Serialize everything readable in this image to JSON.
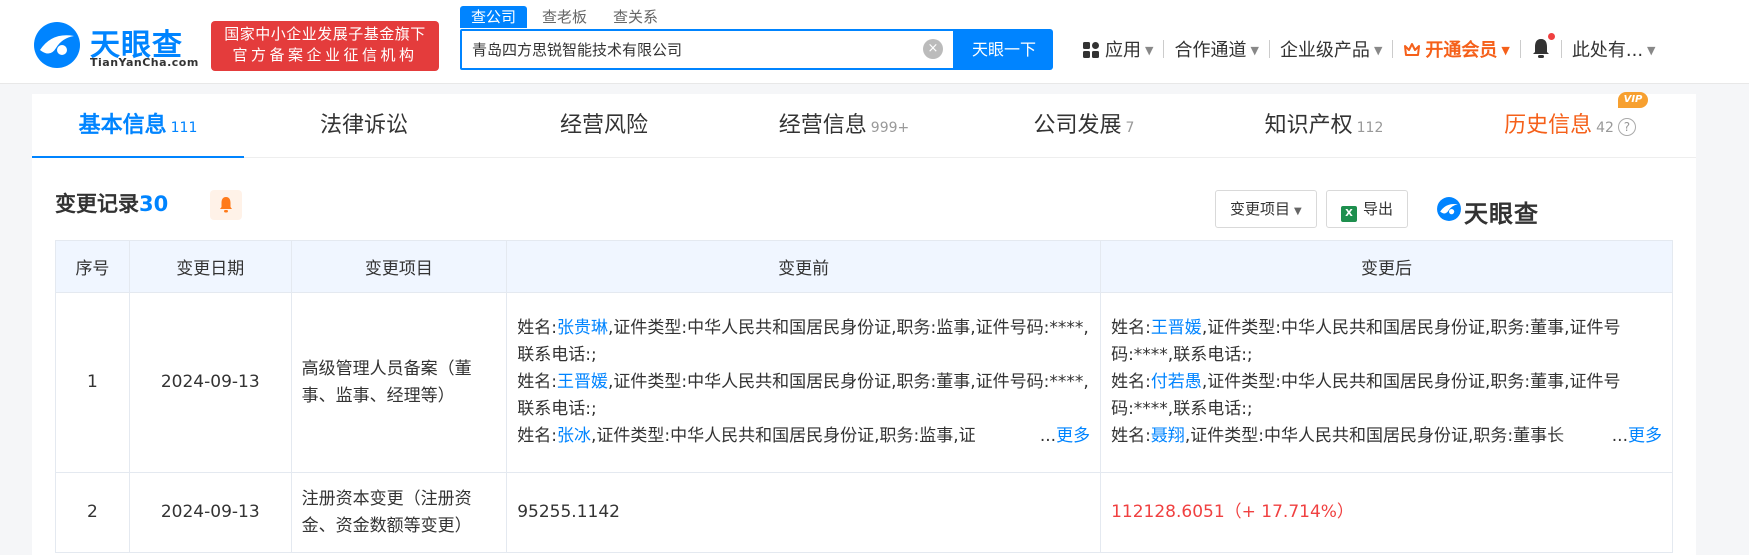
{
  "brand": {
    "logo_text": "天眼查",
    "logo_sub": "TianYanCha.com",
    "badge_line1": "国家中小企业发展子基金旗下",
    "badge_line2": "官方备案企业征信机构"
  },
  "search": {
    "tabs": [
      "查公司",
      "查老板",
      "查关系"
    ],
    "value": "青岛四方思锐智能技术有限公司",
    "button": "天眼一下"
  },
  "nav": {
    "apps": "应用",
    "partner": "合作通道",
    "enterprise": "企业级产品",
    "vip": "开通会员",
    "user": "此处有..."
  },
  "tabs": [
    {
      "label": "基本信息",
      "count": "111"
    },
    {
      "label": "法律诉讼",
      "count": ""
    },
    {
      "label": "经营风险",
      "count": ""
    },
    {
      "label": "经营信息",
      "count": "999+"
    },
    {
      "label": "公司发展",
      "count": "7"
    },
    {
      "label": "知识产权",
      "count": "112"
    },
    {
      "label": "历史信息",
      "count": "42",
      "tag": "VIP"
    }
  ],
  "section": {
    "title": "变更记录",
    "count": "30",
    "filter_btn": "变更项目",
    "export_btn": "导出",
    "watermark": "天眼查"
  },
  "table": {
    "headers": [
      "序号",
      "变更日期",
      "变更项目",
      "变更前",
      "变更后"
    ],
    "rows": [
      {
        "no": "1",
        "date": "2024-09-13",
        "item": "高级管理人员备案（董事、监事、经理等）",
        "before": [
          {
            "prefix": "姓名:",
            "name": "张贵琳",
            "rest": ",证件类型:中华人民共和国居民身份证,职务:监事,证件号码:****,联系电话:;"
          },
          {
            "prefix": "姓名:",
            "name": "王晋媛",
            "rest": ",证件类型:中华人民共和国居民身份证,职务:董事,证件号码:****,联系电话:;"
          },
          {
            "prefix": "姓名:",
            "name": "张冰",
            "rest": ",证件类型:中华人民共和国居民身份证,职务:监事,证"
          }
        ],
        "after": [
          {
            "prefix": "姓名:",
            "name": "王晋媛",
            "rest": ",证件类型:中华人民共和国居民身份证,职务:董事,证件号码:****,联系电话:;"
          },
          {
            "prefix": "姓名:",
            "name": "付若愚",
            "rest": ",证件类型:中华人民共和国居民身份证,职务:董事,证件号码:****,联系电话:;"
          },
          {
            "prefix": "姓名:",
            "name": "聂翔",
            "rest": ",证件类型:中华人民共和国居民身份证,职务:董事长"
          }
        ],
        "more_label": "...",
        "more_link": "更多"
      },
      {
        "no": "2",
        "date": "2024-09-13",
        "item": "注册资本变更（注册资金、资金数额等变更）",
        "before_text": "95255.1142",
        "after_text": "112128.6051（+ 17.714%）"
      }
    ]
  },
  "colors": {
    "primary": "#0084ff",
    "badge_red": "#e43c3c",
    "vip_orange": "#f5601a",
    "increase_red": "#f04040"
  }
}
